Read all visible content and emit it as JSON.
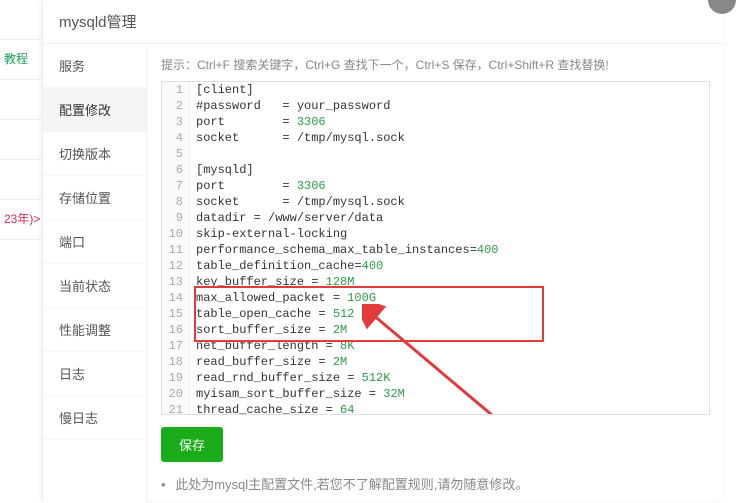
{
  "bg_rows": [
    "",
    "教程",
    "",
    "",
    "",
    "23年)>"
  ],
  "modal": {
    "title": "mysqld管理",
    "sidebar": [
      {
        "label": "服务",
        "active": false
      },
      {
        "label": "配置修改",
        "active": true
      },
      {
        "label": "切换版本",
        "active": false
      },
      {
        "label": "存储位置",
        "active": false
      },
      {
        "label": "端口",
        "active": false
      },
      {
        "label": "当前状态",
        "active": false
      },
      {
        "label": "性能调整",
        "active": false
      },
      {
        "label": "日志",
        "active": false
      },
      {
        "label": "慢日志",
        "active": false
      }
    ],
    "hint": "提示：Ctrl+F 搜索关键字，Ctrl+G 查找下一个，Ctrl+S 保存，Ctrl+Shift+R 查找替换!",
    "code_lines": [
      "[client]",
      "#password   = your_password",
      "port        = 3306",
      "socket      = /tmp/mysql.sock",
      "",
      "[mysqld]",
      "port        = 3306",
      "socket      = /tmp/mysql.sock",
      "datadir = /www/server/data",
      "skip-external-locking",
      "performance_schema_max_table_instances=400",
      "table_definition_cache=400",
      "key_buffer_size = 128M",
      "max_allowed_packet = 100G",
      "table_open_cache = 512",
      "sort_buffer_size = 2M",
      "net_buffer_length = 8K",
      "read_buffer_size = 2M",
      "read_rnd_buffer_size = 512K",
      "myisam_sort_buffer_size = 32M",
      "thread_cache_size = 64"
    ],
    "save_label": "保存",
    "note": "此处为mysql主配置文件,若您不了解配置规则,请勿随意修改。"
  }
}
